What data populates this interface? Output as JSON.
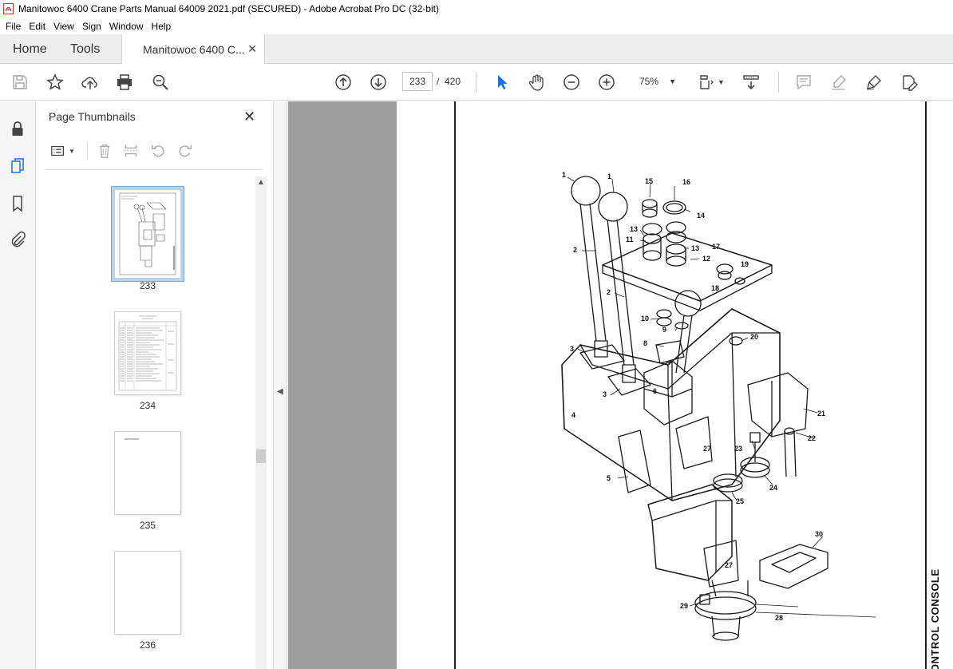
{
  "window": {
    "title": "Manitowoc 6400 Crane Parts Manual 64009 2021.pdf (SECURED) - Adobe Acrobat Pro DC (32-bit)"
  },
  "menu": [
    "File",
    "Edit",
    "View",
    "Sign",
    "Window",
    "Help"
  ],
  "tabs": {
    "home": "Home",
    "tools": "Tools",
    "document": "Manitowoc 6400 C..."
  },
  "toolbar": {
    "current_page": "233",
    "separator": "/",
    "total_pages": "420",
    "zoom": "75%"
  },
  "thumbnails_panel": {
    "title": "Page Thumbnails",
    "pages": [
      {
        "label": "233",
        "selected": true
      },
      {
        "label": "234",
        "selected": false
      },
      {
        "label": "235",
        "selected": false
      },
      {
        "label": "236",
        "selected": false
      }
    ]
  },
  "document": {
    "side_label": "ONTROL CONSOLE",
    "callouts": [
      "1",
      "1",
      "15",
      "16",
      "14",
      "13",
      "11",
      "13",
      "12",
      "17",
      "19",
      "18",
      "2",
      "2",
      "10",
      "9",
      "20",
      "8",
      "3",
      "3",
      "6",
      "4",
      "21",
      "22",
      "23",
      "27",
      "5",
      "24",
      "25",
      "30",
      "27",
      "29",
      "28"
    ]
  },
  "colors": {
    "accent": "#1473e6",
    "pdf_red": "#d9302c",
    "doc_background": "#9e9e9e"
  }
}
